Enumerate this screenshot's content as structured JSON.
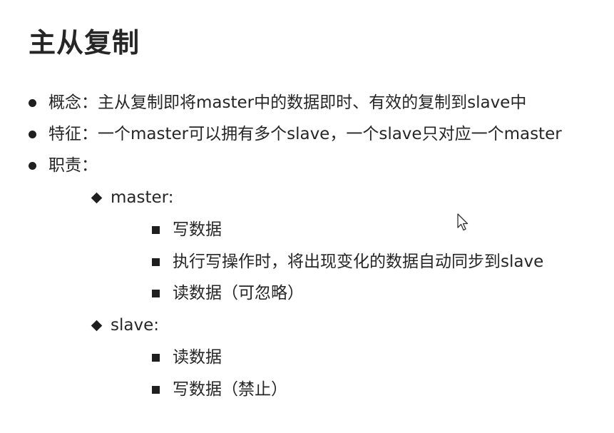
{
  "title": "主从复制",
  "level1": [
    {
      "text": "概念：主从复制即将master中的数据即时、有效的复制到slave中"
    },
    {
      "text": "特征：一个master可以拥有多个slave，一个slave只对应一个master"
    },
    {
      "text": "职责："
    }
  ],
  "roles": [
    {
      "label": "master:",
      "duties": [
        "写数据",
        "执行写操作时，将出现变化的数据自动同步到slave",
        "读数据（可忽略）"
      ]
    },
    {
      "label": "slave:",
      "duties": [
        "读数据",
        "写数据（禁止）"
      ]
    }
  ],
  "icons": {
    "level1_bullet": "circle-bullet-icon",
    "level2_bullet": "diamond-bullet-icon",
    "level3_bullet": "square-bullet-icon",
    "pointer": "mouse-cursor-icon"
  },
  "colors": {
    "text": "#262626",
    "bullet": "#1f1f1f",
    "background": "#ffffff"
  }
}
